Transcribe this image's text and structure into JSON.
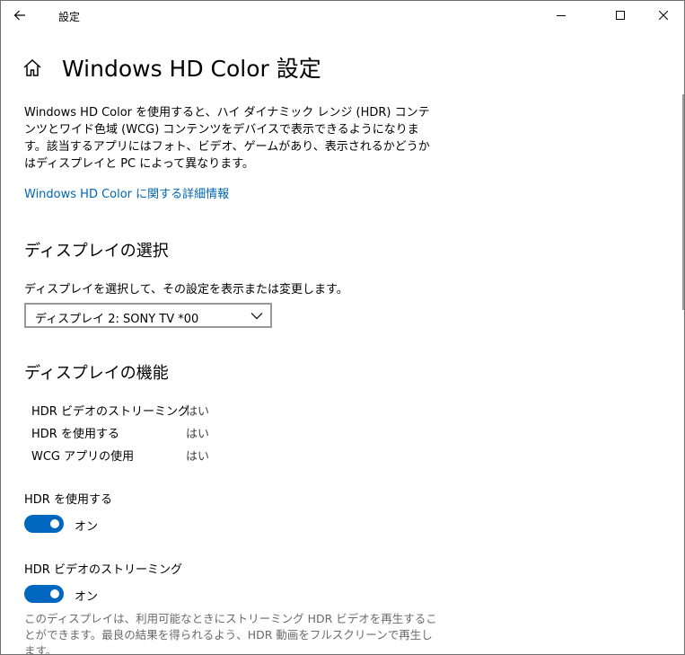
{
  "window": {
    "title": "設定"
  },
  "page": {
    "title": "Windows HD Color 設定",
    "description": "Windows HD Color を使用すると、ハイ ダイナミック レンジ (HDR) コンテンツとワイド色域 (WCG) コンテンツをデバイスで表示できるようになります。該当するアプリにはフォト、ビデオ、ゲームがあり、表示されるかどうかはディスプレイと PC によって異なります。",
    "link": "Windows HD Color に関する詳細情報"
  },
  "display_select": {
    "heading": "ディスプレイの選択",
    "subtitle": "ディスプレイを選択して、その設定を表示または変更します。",
    "selected": "ディスプレイ 2: SONY TV  *00"
  },
  "capabilities": {
    "heading": "ディスプレイの機能",
    "rows": [
      {
        "label": "HDR ビデオのストリーミング",
        "value": "はい"
      },
      {
        "label": "HDR を使用する",
        "value": "はい"
      },
      {
        "label": "WCG アプリの使用",
        "value": "はい"
      }
    ]
  },
  "use_hdr": {
    "label": "HDR を使用する",
    "state": "オン"
  },
  "hdr_streaming": {
    "label": "HDR ビデオのストリーミング",
    "state": "オン",
    "note": "このディスプレイは、利用可能なときにストリーミング HDR ビデオを再生することができます。最良の結果を得られるよう、HDR 動画をフルスクリーンで再生します。"
  },
  "colors": {
    "accent": "#0067c0",
    "link": "#0066b4"
  }
}
